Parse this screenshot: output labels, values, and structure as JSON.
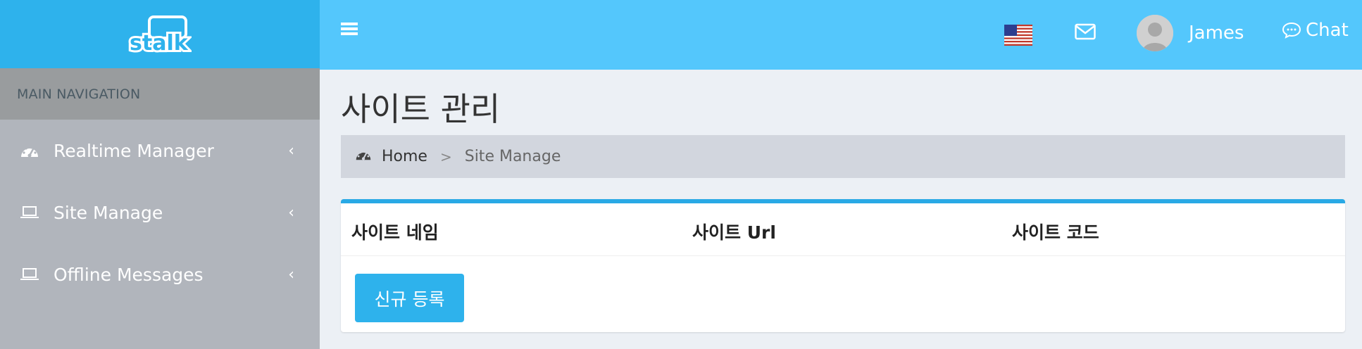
{
  "brand": {
    "logo_text": "stalk"
  },
  "sidebar": {
    "header": "MAIN NAVIGATION",
    "items": [
      {
        "label": "Realtime Manager",
        "icon": "dashboard-icon"
      },
      {
        "label": "Site Manage",
        "icon": "laptop-icon"
      },
      {
        "label": "Offline Messages",
        "icon": "laptop-icon"
      }
    ]
  },
  "topbar": {
    "user_name": "James",
    "chat_label": "Chat",
    "language_flag": "us-flag-icon"
  },
  "page": {
    "title": "사이트 관리",
    "breadcrumb": {
      "home": "Home",
      "separator": ">",
      "current": "Site Manage"
    }
  },
  "table": {
    "columns": [
      "사이트 네임",
      "사이트 Url",
      "사이트 코드"
    ],
    "rows": []
  },
  "actions": {
    "new_button": "신규 등록"
  },
  "colors": {
    "accent": "#2eb2ec",
    "topbar": "#54c7fc",
    "sidebar": "#b1b5bc",
    "background": "#ecf0f5"
  }
}
